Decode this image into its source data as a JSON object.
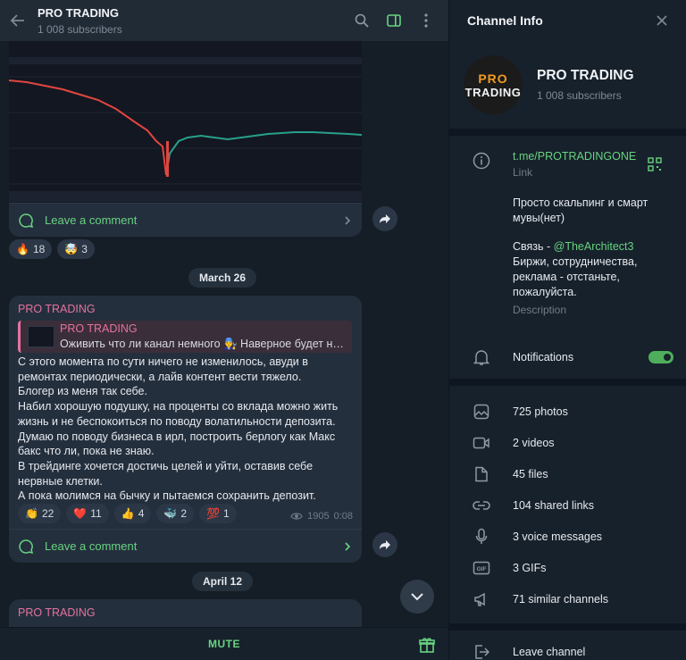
{
  "chat": {
    "title": "PRO TRADING",
    "subscribers": "1 008 subscribers"
  },
  "post1": {
    "comment_label": "Leave a comment",
    "reactions": [
      {
        "emoji": "🔥",
        "count": "18"
      },
      {
        "emoji": "🤯",
        "count": "3"
      }
    ]
  },
  "date1": "March 26",
  "post2": {
    "sender": "PRO TRADING",
    "quote_name": "PRO TRADING",
    "quote_text": "Оживить что ли канал немного 👨‍🔧 Наверное будет не...",
    "lines": [
      "С этого момента по сути ничего не изменилось, авуди в",
      "ремонтах периодически, а лайв контент вести тяжело.",
      "Блогер из меня так себе.",
      "Набил хорошую подушку, на проценты со вклада можно жить",
      "жизнь и не беспокоиться по поводу волатильности депозита.",
      "Думаю по поводу бизнеса в ирл, построить берлогу как Макс",
      "бакс что ли, пока не знаю.",
      "В трейдинге хочется достичь целей и уйти, оставив себе",
      "нервные клетки.",
      "А пока молимся на бычку и пытаемся сохранить депозит."
    ],
    "reactions": [
      {
        "emoji": "👏",
        "count": "22"
      },
      {
        "emoji": "❤️",
        "count": "11"
      },
      {
        "emoji": "👍",
        "count": "4"
      },
      {
        "emoji": "🐳",
        "count": "2"
      },
      {
        "emoji": "💯",
        "count": "1"
      }
    ],
    "views": "1905",
    "time": "0:08",
    "comment_label": "Leave a comment"
  },
  "date2": "April 12",
  "post3": {
    "sender": "PRO TRADING"
  },
  "footer": {
    "mute_label": "MUTE"
  },
  "info": {
    "header": "Channel Info",
    "avatar_line1": "PRO",
    "avatar_line2": "TRADING",
    "name": "PRO TRADING",
    "subscribers": "1 008 subscribers",
    "link": "t.me/PROTRADINGONE",
    "link_caption": "Link",
    "desc_line1": "Просто скальпинг и смарт мувы(нет)",
    "desc_contact_prefix": "Связь - ",
    "desc_contact_handle": "@TheArchitect3",
    "desc_line3": "Биржи, сотрудничества, реклама - отстаньте, пожалуйста.",
    "desc_caption": "Description",
    "notifications": "Notifications",
    "media": {
      "photos": "725 photos",
      "videos": "2 videos",
      "files": "45 files",
      "links": "104 shared links",
      "voice": "3 voice messages",
      "gifs": "3 GIFs",
      "similar": "71 similar channels"
    },
    "leave": "Leave channel"
  },
  "colors": {
    "accent_green": "#68d382",
    "sender_pink": "#e472a0",
    "bg_dark": "#17212b"
  }
}
